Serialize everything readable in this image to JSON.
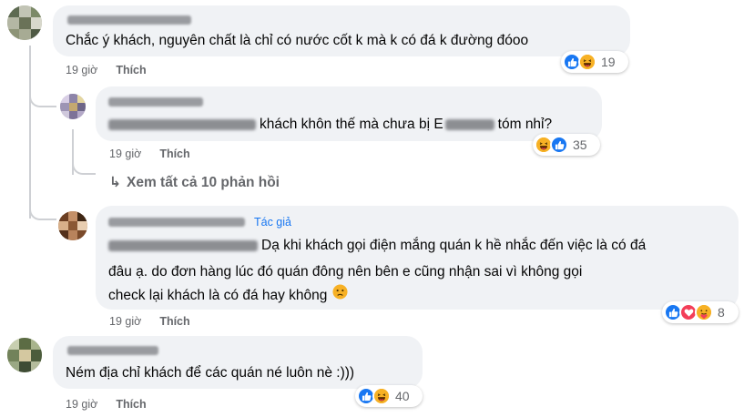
{
  "comments": [
    {
      "text": "Chắc ý khách, nguyên chất là chỉ có nước cốt k mà k có đá k đường đóoo",
      "time": "19 giờ",
      "like": "Thích",
      "reaction_count": "19",
      "reactions": [
        "like-icon",
        "haha-icon"
      ]
    },
    {
      "text": "khách khôn thế mà chưa bị E",
      "text_tail": "tóm nhỉ?",
      "time": "19 giờ",
      "like": "Thích",
      "reaction_count": "35",
      "reactions": [
        "haha-icon",
        "like-icon"
      ]
    },
    {
      "author_badge": "Tác giả",
      "text_line1": "Dạ khi khách gọi điện mắng quán k hề nhắc đến việc là có đá",
      "text_line2": "đâu ạ. do đơn hàng lúc đó quán đông nên bên e cũng nhận sai vì không gọi",
      "text_line3": "check lại khách là có đá hay không",
      "time": "19 giờ",
      "like": "Thích",
      "reaction_count": "8",
      "reactions": [
        "like-icon",
        "love-icon",
        "care-icon"
      ]
    },
    {
      "text": "Ném địa chỉ khách để các quán né luôn nè :)))",
      "time": "19 giờ",
      "like": "Thích",
      "reaction_count": "40",
      "reactions": [
        "like-icon",
        "haha-icon"
      ]
    }
  ],
  "see_all_replies": "Xem tất cả 10 phản hồi",
  "colors": {
    "bubble": "#f0f2f5",
    "like_blue": "#1877f2",
    "love_red": "#f33e58",
    "haha_yellow": "#f7b125",
    "meta_gray": "#65676b"
  }
}
